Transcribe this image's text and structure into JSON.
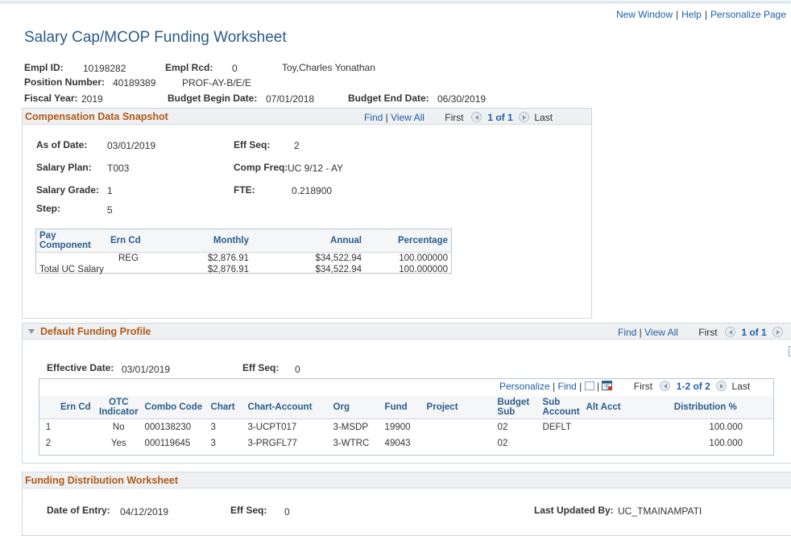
{
  "links": {
    "new_window": "New Window",
    "help": "Help",
    "personalize_page": "Personalize Page"
  },
  "title": "Salary Cap/MCOP Funding Worksheet",
  "header": {
    "empl_id_label": "Empl ID:",
    "empl_id": "10198282",
    "empl_rcd_label": "Empl Rcd:",
    "empl_rcd": "0",
    "name": "Toy,Charles Yonathan",
    "position_label": "Position Number:",
    "position": "40189389",
    "position_desc": "PROF-AY-B/E/E",
    "fiscal_year_label": "Fiscal Year:",
    "fiscal_year": "2019",
    "budget_begin_label": "Budget Begin Date:",
    "budget_begin": "07/01/2018",
    "budget_end_label": "Budget End Date:",
    "budget_end": "06/30/2019"
  },
  "comp": {
    "title": "Compensation Data Snapshot",
    "nav": {
      "find": "Find",
      "view_all": "View All",
      "first": "First",
      "count": "1 of 1",
      "last": "Last"
    },
    "as_of_label": "As of Date:",
    "as_of": "03/01/2019",
    "eff_seq_label": "Eff Seq:",
    "eff_seq": "2",
    "plan_label": "Salary Plan:",
    "plan": "T003",
    "comp_freq_label": "Comp Freq:",
    "comp_freq": "UC 9/12 - AY",
    "grade_label": "Salary Grade:",
    "grade": "1",
    "fte_label": "FTE:",
    "fte": "0.218900",
    "step_label": "Step:",
    "step": "5",
    "table": {
      "headers": [
        "Pay Component",
        "Ern Cd",
        "Monthly",
        "Annual",
        "Percentage"
      ],
      "rows": [
        [
          "",
          "REG",
          "$2,876.91",
          "$34,522.94",
          "100.000000"
        ],
        [
          "Total UC Salary",
          "",
          "$2,876.91",
          "$34,522.94",
          "100.000000"
        ]
      ]
    }
  },
  "funding": {
    "title": "Default Funding Profile",
    "nav": {
      "find": "Find",
      "view_all": "View All",
      "first": "First",
      "count": "1 of 1"
    },
    "eff_date_label": "Effective Date:",
    "eff_date": "03/01/2019",
    "eff_seq_label": "Eff Seq:",
    "eff_seq": "0",
    "grid_nav": {
      "personalize": "Personalize",
      "find": "Find",
      "first": "First",
      "count": "1-2 of 2",
      "last": "Last"
    },
    "table": {
      "headers": [
        "",
        "Ern Cd",
        "OTC Indicator",
        "Combo Code",
        "Chart",
        "Chart-Account",
        "Org",
        "Fund",
        "Project",
        "Budget Sub",
        "Sub Account",
        "Alt Acct",
        "Distribution %"
      ],
      "rows": [
        [
          "1",
          "",
          "No",
          "000138230",
          "3",
          "3-UCPT017",
          "3-MSDP",
          "19900",
          "",
          "02",
          "DEFLT",
          "",
          "100.000"
        ],
        [
          "2",
          "",
          "Yes",
          "000119645",
          "3",
          "3-PRGFL77",
          "3-WTRC",
          "49043",
          "",
          "02",
          "",
          "",
          "100.000"
        ]
      ]
    }
  },
  "distribution": {
    "title": "Funding Distribution Worksheet",
    "entry_label": "Date of Entry:",
    "entry": "04/12/2019",
    "eff_seq_label": "Eff Seq:",
    "eff_seq": "0",
    "updated_label": "Last Updated By:",
    "updated": "UC_TMAINAMPATI"
  }
}
